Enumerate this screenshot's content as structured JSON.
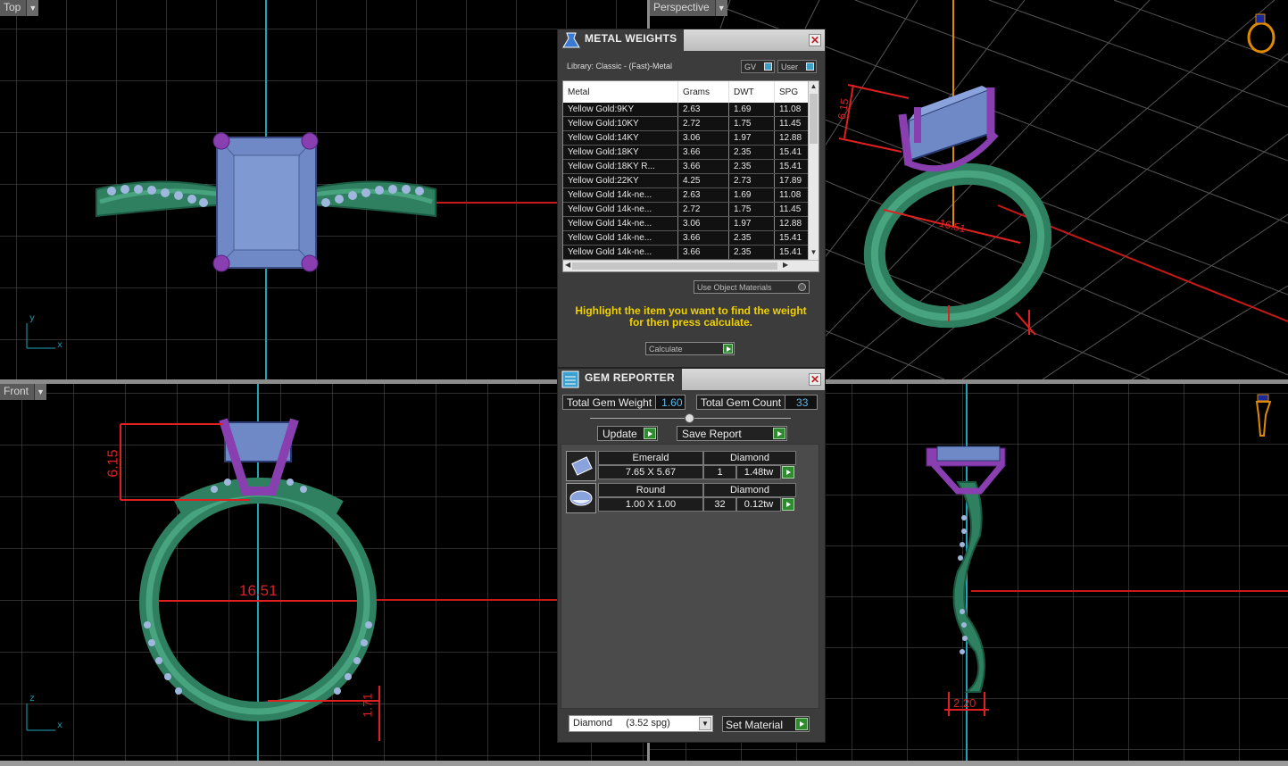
{
  "viewports": {
    "top": {
      "label": "Top",
      "axis_x": "x",
      "axis_y": "y"
    },
    "perspective": {
      "label": "Perspective",
      "dim_height": "6.15",
      "dim_width": "16.51"
    },
    "front": {
      "label": "Front",
      "axis_x": "x",
      "axis_z": "z",
      "dim_height": "6.15",
      "dim_width": "16.51",
      "dim_band": "1.71"
    },
    "right": {
      "dim_band": "2.20"
    }
  },
  "metal_weights": {
    "title": "METAL WEIGHTS",
    "library": "Library: Classic - (Fast)-Metal",
    "toggle_gv": "GV",
    "toggle_user": "User",
    "columns": [
      "Metal",
      "Grams",
      "DWT",
      "SPG"
    ],
    "rows": [
      [
        "Yellow Gold:9KY",
        "2.63",
        "1.69",
        "11.08"
      ],
      [
        "Yellow Gold:10KY",
        "2.72",
        "1.75",
        "11.45"
      ],
      [
        "Yellow Gold:14KY",
        "3.06",
        "1.97",
        "12.88"
      ],
      [
        "Yellow Gold:18KY",
        "3.66",
        "2.35",
        "15.41"
      ],
      [
        "Yellow Gold:18KY R...",
        "3.66",
        "2.35",
        "15.41"
      ],
      [
        "Yellow Gold:22KY",
        "4.25",
        "2.73",
        "17.89"
      ],
      [
        "Yellow Gold 14k-ne...",
        "2.63",
        "1.69",
        "11.08"
      ],
      [
        "Yellow Gold 14k-ne...",
        "2.72",
        "1.75",
        "11.45"
      ],
      [
        "Yellow Gold 14k-ne...",
        "3.06",
        "1.97",
        "12.88"
      ],
      [
        "Yellow Gold 14k-ne...",
        "3.66",
        "2.35",
        "15.41"
      ],
      [
        "Yellow Gold 14k-ne...",
        "3.66",
        "2.35",
        "15.41"
      ]
    ],
    "use_object_materials": "Use Object Materials",
    "hint": "Highlight the item you want to find the weight for then press calculate.",
    "calculate_label": "Calculate"
  },
  "gem_reporter": {
    "title": "GEM REPORTER",
    "total_weight_label": "Total Gem Weight",
    "total_weight_value": "1.60",
    "total_count_label": "Total Gem Count",
    "total_count_value": "33",
    "update_label": "Update",
    "save_label": "Save Report",
    "gems": [
      {
        "shape": "Emerald",
        "size": "7.65 X 5.67",
        "material": "Diamond",
        "count": "1",
        "weight": "1.48tw"
      },
      {
        "shape": "Round",
        "size": "1.00 X 1.00",
        "material": "Diamond",
        "count": "32",
        "weight": "0.12tw"
      }
    ],
    "material_select": "Diamond     (3.52 spg)",
    "set_material_label": "Set Material"
  },
  "colors": {
    "shank": "#2f8060",
    "stone": "#6f89c6",
    "prong": "#8a3fb0",
    "dimension": "#e02020",
    "grid": "#5a5a5a",
    "axis_cyan": "#1ea6b8",
    "accent_yellow": "#f0d000"
  }
}
